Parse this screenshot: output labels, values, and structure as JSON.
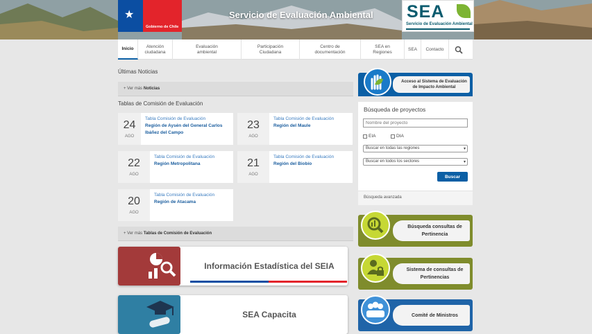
{
  "header": {
    "gob_label": "Gobierno de Chile",
    "site_title": "Servicio de Evaluación Ambiental",
    "logo_letters": "SEA",
    "logo_subtitle": "Servicio de Evaluación Ambiental"
  },
  "nav": {
    "items": [
      {
        "label": "Inicio",
        "active": true
      },
      {
        "label": "Atención ciudadana"
      },
      {
        "label": "Evaluación ambiental"
      },
      {
        "label": "Participación Ciudadana"
      },
      {
        "label": "Centro de documentación"
      },
      {
        "label": "SEA en Regiones"
      },
      {
        "label": "SEA"
      },
      {
        "label": "Contacto"
      }
    ],
    "search_icon": "search-icon"
  },
  "news": {
    "title": "Últimas Noticias",
    "more_prefix": "+ Ver más",
    "more_target": "Noticias"
  },
  "commission": {
    "title": "Tablas de Comisión de Evaluación",
    "cards": [
      {
        "day": "24",
        "month": "AGO",
        "kind": "Tabla Comisión de Evaluación",
        "region": "Región de Aysén del General Carlos Ibáñez del Campo"
      },
      {
        "day": "23",
        "month": "AGO",
        "kind": "Tabla Comisión de Evaluación",
        "region": "Región del Maule"
      },
      {
        "day": "22",
        "month": "AGO",
        "kind": "Tabla Comisión de Evaluación",
        "region": "Región Metropolitana"
      },
      {
        "day": "21",
        "month": "AGO",
        "kind": "Tabla Comisión de Evaluación",
        "region": "Región del Biobío"
      },
      {
        "day": "20",
        "month": "AGO",
        "kind": "Tabla Comisión de Evaluación",
        "region": "Región de Atacama"
      }
    ],
    "more_prefix": "+ Ver más",
    "more_target": "Tablas de Comisión de Evaluación"
  },
  "banners": [
    {
      "label": "Información Estadística del SEIA",
      "icon": "chart-magnifier-icon",
      "color": "#a33a3a"
    },
    {
      "label": "SEA Capacita",
      "icon": "graduation-cap-icon",
      "color": "#2f7fa3"
    }
  ],
  "access": {
    "label": "Acceso al Sistema de Evaluación de Impacto Ambiental",
    "icon": "hand-leaf-icon"
  },
  "project_search": {
    "title": "Búsqueda de proyectos",
    "name_placeholder": "Nombre del proyecto",
    "eia_label": "EIA",
    "dia_label": "DIA",
    "region_select": "Buscar en todas las regiones",
    "sector_select": "Buscar en todos los sectores",
    "button": "Buscar",
    "advanced": "Búsqueda avanzada"
  },
  "side_buttons": [
    {
      "label": "Búsqueda consultas de Pertinencia",
      "icon": "magnifier-chart-icon",
      "style": "green"
    },
    {
      "label": "Sistema de consultas de Pertinencias",
      "icon": "user-lock-icon",
      "style": "green"
    },
    {
      "label": "Comité de Ministros",
      "icon": "group-icon",
      "style": "blue"
    }
  ]
}
